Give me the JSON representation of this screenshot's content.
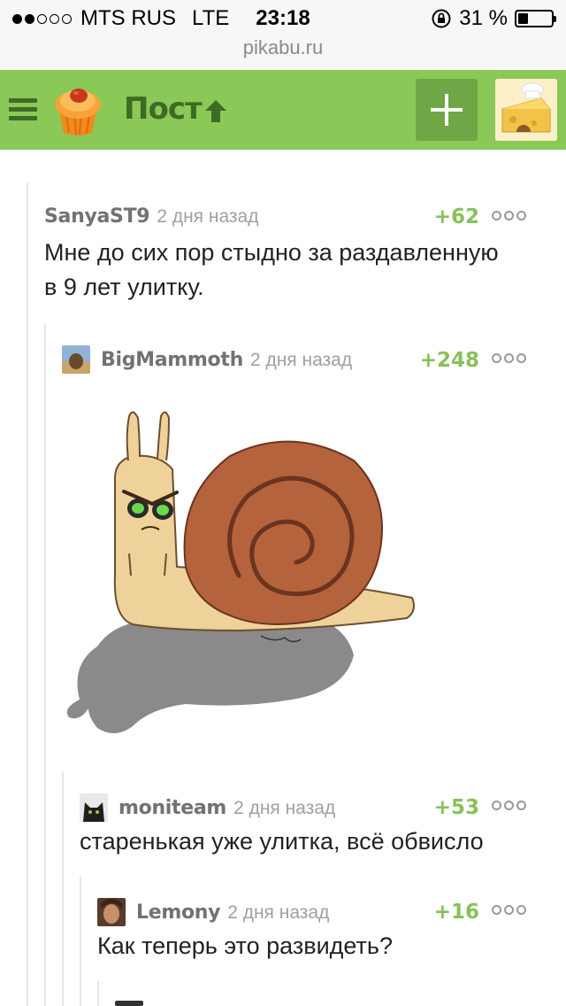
{
  "status_bar": {
    "carrier": "MTS RUS",
    "network": "LTE",
    "time": "23:18",
    "battery": "31 %",
    "signal_bars": 2,
    "battery_level": 0.31
  },
  "browser": {
    "url": "pikabu.ru"
  },
  "header": {
    "title": "Пост",
    "accent": "#8ac858",
    "dark": "#3e6b24",
    "icons": {
      "menu": "hamburger-menu-icon",
      "logo": "pikabu-cupcake-logo",
      "up": "arrow-up-icon",
      "add": "plus-icon"
    }
  },
  "comments": [
    {
      "author": "SanyaST9",
      "time": "2 дня назад",
      "score": "+62",
      "text": [
        "Мне до сих пор стыдно за раздавленную",
        "в 9 лет улитку."
      ]
    },
    {
      "author": "BigMammoth",
      "time": "2 дня назад",
      "score": "+248",
      "has_image": true
    },
    {
      "author": "moniteam",
      "time": "2 дня назад",
      "score": "+53",
      "text": [
        "старенькая уже улитка, всё обвисло"
      ]
    },
    {
      "author": "Lemony",
      "time": "2 дня назад",
      "score": "+16",
      "text": [
        "Как теперь это развидеть?"
      ]
    }
  ],
  "colors": {
    "score": "#86c15a",
    "author": "#727272",
    "time": "#a0a0a0"
  }
}
